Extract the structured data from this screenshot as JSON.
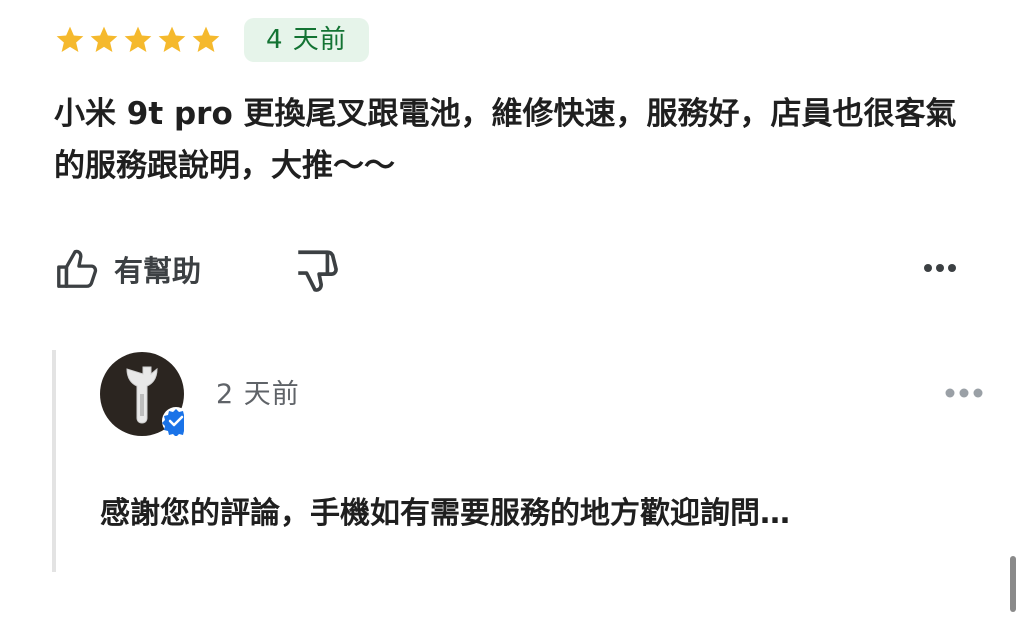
{
  "review": {
    "rating": 5,
    "rating_max": 5,
    "star_color": "#f5b92d",
    "time_badge": "4 天前",
    "text": "小米 9t pro 更換尾叉跟電池，維修快速，服務好，店員也很客氣的服務跟說明，大推～～"
  },
  "actions": {
    "helpful_label": "有幫助",
    "icons": {
      "helpful": "thumbs-up-icon",
      "not_helpful": "thumbs-down-icon",
      "more": "more-horizontal-icon"
    }
  },
  "owner_reply": {
    "avatar_icon": "wrench-icon",
    "verified_icon": "verified-badge-icon",
    "verified_color": "#1a73e8",
    "time": "2 天前",
    "text": "感謝您的評論，手機如有需要服務的地方歡迎詢問…"
  }
}
